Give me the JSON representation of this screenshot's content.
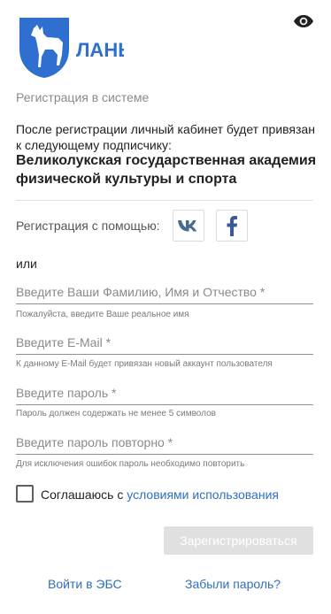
{
  "header": {
    "logo_text": "ЛАНЬ",
    "eye_icon": "eye-icon"
  },
  "registration": {
    "title": "Регистрация в системе",
    "intro": "После регистрации личный кабинет будет привязан к следующему подписчику:",
    "organization": "Великолукская государственная академия физической культуры и спорта"
  },
  "social": {
    "label": "Регистрация с помощью:",
    "buttons": [
      {
        "name": "vk",
        "glyph": "vk"
      },
      {
        "name": "facebook",
        "glyph": "f"
      }
    ]
  },
  "or_label": "или",
  "fields": {
    "fullname": {
      "label": "Введите Ваши Фамилию, Имя и Отчество *",
      "hint": "Пожалуйста, введите Ваше реальное имя"
    },
    "email": {
      "label": "Введите E-Mail *",
      "hint": "К данному E-Mail будет привязан новый аккаунт пользователя"
    },
    "password": {
      "label": "Введите пароль *",
      "hint": "Пароль должен содержать не менее 5 символов"
    },
    "password_repeat": {
      "label": "Введите пароль повторно *",
      "hint": "Для исключения ошибок пароль необходимо повторить"
    }
  },
  "agreement": {
    "text": "Соглашаюсь с",
    "link": "условиями использования",
    "checked": false
  },
  "submit_label": "Зарегистрироваться",
  "footer": {
    "login_link": "Войти в ЭБС",
    "forgot_link": "Забыли пароль?"
  },
  "colors": {
    "brand_blue": "#2f6fd0",
    "link_blue": "#2f6fbf",
    "disabled_button": "#e0e0e0"
  }
}
